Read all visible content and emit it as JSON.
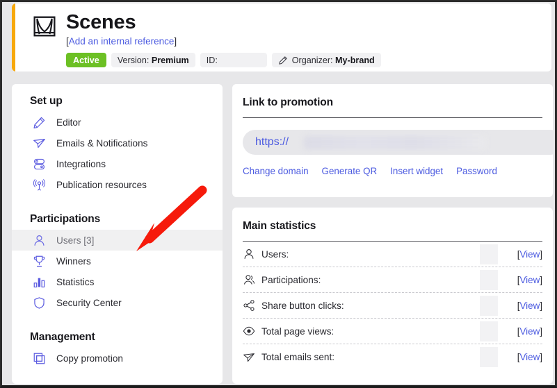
{
  "header": {
    "icon": "stage-curtain-icon",
    "title": "Scenes",
    "internal_ref_open": "[",
    "internal_ref_link": "Add an internal reference",
    "internal_ref_close": "]",
    "badges": {
      "status": "Active",
      "version_label": "Version:",
      "version_value": "Premium",
      "id_label": "ID:",
      "id_value": "",
      "organizer_label": "Organizer:",
      "organizer_value": "My-brand",
      "organizer_icon": "pencil-icon"
    },
    "accent_color": "#f7a80b",
    "status_color": "#6cc024"
  },
  "sidebar": {
    "sections": [
      {
        "title": "Set up",
        "items": [
          {
            "label": "Editor",
            "icon": "pencil-icon",
            "selected": false
          },
          {
            "label": "Emails & Notifications",
            "icon": "paper-plane-icon",
            "selected": false
          },
          {
            "label": "Integrations",
            "icon": "server-icon",
            "selected": false
          },
          {
            "label": "Publication resources",
            "icon": "broadcast-icon",
            "selected": false
          }
        ]
      },
      {
        "title": "Participations",
        "items": [
          {
            "label": "Users [3]",
            "icon": "user-icon",
            "selected": true
          },
          {
            "label": "Winners",
            "icon": "trophy-icon",
            "selected": false
          },
          {
            "label": "Statistics",
            "icon": "bar-chart-icon",
            "selected": false
          },
          {
            "label": "Security Center",
            "icon": "shield-icon",
            "selected": false
          }
        ]
      },
      {
        "title": "Management",
        "items": [
          {
            "label": "Copy promotion",
            "icon": "copy-icon",
            "selected": false
          }
        ]
      }
    ]
  },
  "link_card": {
    "title": "Link to promotion",
    "url_scheme": "https://",
    "url_value": "",
    "actions": [
      "Change domain",
      "Generate QR",
      "Insert widget",
      "Password"
    ]
  },
  "stats_card": {
    "title": "Main statistics",
    "view_open": "[",
    "view_label": "View",
    "view_close": "]",
    "rows": [
      {
        "label": "Users:",
        "icon": "user-icon",
        "value": ""
      },
      {
        "label": "Participations:",
        "icon": "users-group-icon",
        "value": ""
      },
      {
        "label": "Share button clicks:",
        "icon": "share-icon",
        "value": ""
      },
      {
        "label": "Total page views:",
        "icon": "eye-icon",
        "value": ""
      },
      {
        "label": "Total emails sent:",
        "icon": "paper-plane-icon",
        "value": ""
      }
    ]
  },
  "annotation": {
    "arrow": "red-arrow-pointing-to-users",
    "color": "#f61a0b"
  }
}
